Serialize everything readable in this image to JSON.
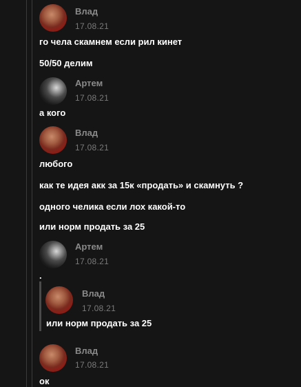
{
  "messages": [
    {
      "author": "Влад",
      "date": "17.08.21",
      "avatar_icon": "avatar-vlad"
    },
    {
      "text": "го чела скамнем если рил кинет"
    },
    {
      "text": "50/50 делим"
    },
    {
      "author": "Артем",
      "date": "17.08.21",
      "avatar_icon": "avatar-artem"
    },
    {
      "text": "а кого"
    },
    {
      "author": "Влад",
      "date": "17.08.21",
      "avatar_icon": "avatar-vlad"
    },
    {
      "text": "любого"
    },
    {
      "text": "как те идея акк за 15к «продать» и скамнуть ?"
    },
    {
      "text": "одного челика если лох какой-то"
    },
    {
      "text": "или норм продать за 25"
    },
    {
      "author": "Артем",
      "date": "17.08.21",
      "avatar_icon": "avatar-artem"
    },
    {
      "text": "."
    },
    {
      "author": "Влад",
      "date": "17.08.21",
      "avatar_icon": "avatar-vlad"
    },
    {
      "text": "или норм продать за 25"
    },
    {
      "author": "Влад",
      "date": "17.08.21",
      "avatar_icon": "avatar-vlad"
    },
    {
      "text": "ок"
    }
  ]
}
